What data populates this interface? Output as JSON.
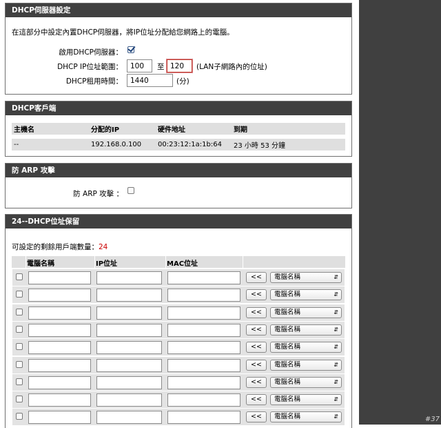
{
  "dhcp_server": {
    "title": "DHCP伺服器設定",
    "description": "在這部分中設定內置DHCP伺服器，將IP位址分配給您網路上的電腦。",
    "enable_label": "啟用DHCP伺服器：",
    "enable_checked": true,
    "range_label": "DHCP IP位址範圍：",
    "range_start": "100",
    "range_to": "至",
    "range_end": "120",
    "range_hint": "(LAN子網路內的位址)",
    "lease_label": "DHCP租用時間：",
    "lease_value": "1440",
    "lease_unit": "(分)"
  },
  "dhcp_clients": {
    "title": "DHCP客戶端",
    "headers": [
      "主機名",
      "分配的IP",
      "硬件地址",
      "到期"
    ],
    "rows": [
      [
        "--",
        "192.168.0.100",
        "00:23:12:1a:1b:64",
        "23 小時 53 分鐘"
      ]
    ]
  },
  "arp": {
    "title": "防 ARP 攻擊",
    "label": "防 ARP 攻擊 ：",
    "checked": false
  },
  "reservation": {
    "title": "24--DHCP位址保留",
    "remaining_label": "可設定的剩餘用戶端數量：",
    "remaining_count": "24",
    "headers": [
      "電腦名稱",
      "IP位址",
      "MAC位址"
    ],
    "copy_button": "<<",
    "select_value": "電腦名稱",
    "rows": [
      {
        "name": "",
        "ip": "",
        "mac": ""
      },
      {
        "name": "",
        "ip": "",
        "mac": ""
      },
      {
        "name": "",
        "ip": "",
        "mac": ""
      },
      {
        "name": "",
        "ip": "",
        "mac": ""
      },
      {
        "name": "",
        "ip": "",
        "mac": ""
      },
      {
        "name": "",
        "ip": "",
        "mac": ""
      },
      {
        "name": "",
        "ip": "",
        "mac": ""
      },
      {
        "name": "",
        "ip": "",
        "mac": ""
      },
      {
        "name": "",
        "ip": "",
        "mac": ""
      }
    ]
  },
  "page_mark": "#37",
  "colors": {
    "section_header": "#404040",
    "table_header_bg": "#dfdfdf",
    "count_red": "#cc0000",
    "highlight_border": "#c0392b"
  }
}
